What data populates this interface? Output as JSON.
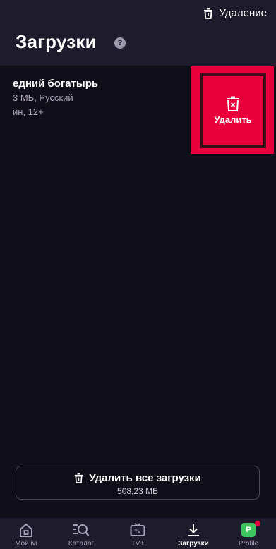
{
  "header": {
    "title": "Загрузки",
    "action_label": "Удаление",
    "help_glyph": "?"
  },
  "item": {
    "title": "едний богатырь",
    "meta_size_lang": "3 МБ, Русский",
    "meta_duration_age": "ин, 12+"
  },
  "swipe_action": {
    "label": "Удалить",
    "icon": "trash-x-icon",
    "color": "#e8003c"
  },
  "delete_all": {
    "label": "Удалить все загрузки",
    "size": "508,23 МБ"
  },
  "nav": {
    "items": [
      {
        "label": "Мой ivi",
        "icon": "home-icon"
      },
      {
        "label": "Каталог",
        "icon": "catalog-search-icon"
      },
      {
        "label": "TV+",
        "icon": "tv-icon"
      },
      {
        "label": "Загрузки",
        "icon": "download-icon",
        "active": true
      },
      {
        "label": "Profile",
        "icon": "profile-avatar",
        "avatar_letter": "P"
      }
    ]
  },
  "colors": {
    "background": "#100e19",
    "header": "#1e1b2c",
    "accent": "#e8003c",
    "avatar": "#3ec45e"
  }
}
